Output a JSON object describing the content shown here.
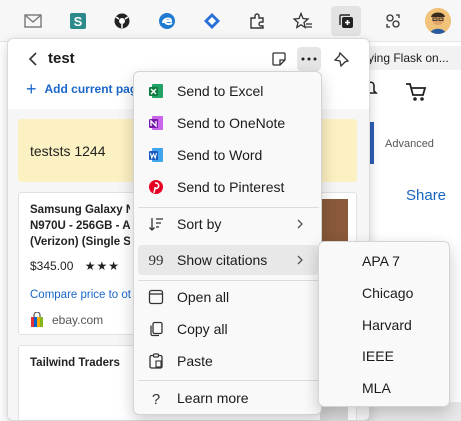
{
  "toolbar": {
    "icons": [
      "mail-icon",
      "sway-icon",
      "football-icon",
      "edge-icon",
      "jira-icon",
      "extensions-icon",
      "favorites-icon",
      "collections-icon",
      "profile-switch-icon",
      "avatar"
    ]
  },
  "background": {
    "tab_title": "ying Flask on...",
    "advanced": "Advanced",
    "share": "Share"
  },
  "collections": {
    "title": "test",
    "add_current_page": "Add current pag",
    "note_text": "teststs 1244",
    "card1": {
      "title_lines": [
        "Samsung Galaxy No",
        "N970U - 256GB - A",
        "(Verizon) (Single SI"
      ],
      "price": "$345.00",
      "rating_stars": "★★★",
      "compare": "Compare price to ot",
      "site": "ebay.com"
    },
    "card2": {
      "title": "Tailwind Traders"
    }
  },
  "menu": {
    "items": [
      {
        "label": "Send to Excel",
        "icon": "excel-icon"
      },
      {
        "label": "Send to OneNote",
        "icon": "onenote-icon"
      },
      {
        "label": "Send to Word",
        "icon": "word-icon"
      },
      {
        "label": "Send to Pinterest",
        "icon": "pinterest-icon"
      },
      {
        "label": "Sort by",
        "icon": "sort-icon"
      },
      {
        "label": "Show citations",
        "icon": "quote-icon"
      },
      {
        "label": "Open all",
        "icon": "open-all-icon"
      },
      {
        "label": "Copy all",
        "icon": "copy-icon"
      },
      {
        "label": "Paste",
        "icon": "paste-icon"
      },
      {
        "label": "Learn more",
        "icon": "help-icon"
      }
    ]
  },
  "citations_submenu": {
    "items": [
      "APA 7",
      "Chicago",
      "Harvard",
      "IEEE",
      "MLA"
    ]
  },
  "colors": {
    "accent_blue": "#1a66c9",
    "note_yellow": "#fcf1c2",
    "excel_green": "#1d6f42",
    "onenote_purple": "#7719aa",
    "word_blue": "#2b579a",
    "pinterest_red": "#e60023"
  }
}
